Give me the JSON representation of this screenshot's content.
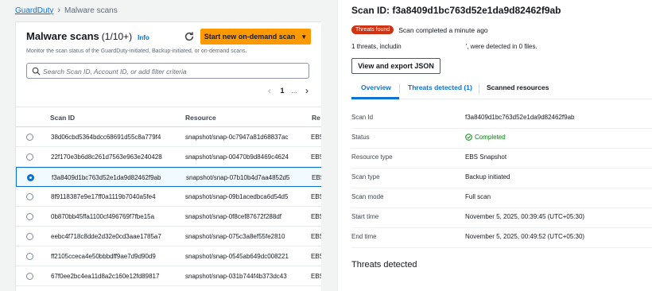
{
  "breadcrumb": {
    "root": "GuardDuty",
    "current": "Malware scans"
  },
  "left_panel": {
    "title": "Malware scans",
    "count": "(1/10+)",
    "info": "Info",
    "start_button": "Start new on-demand scan",
    "description": "Monitor the scan status of the GuardDuty-initiated, Backup-initiated, or on-demand scans.",
    "search_placeholder": "Search Scan ID, Account ID, or add filter criteria",
    "pagination": {
      "prev": "‹",
      "page": "1",
      "ellipsis": "...",
      "next": "›"
    },
    "columns": {
      "scan_id": "Scan ID",
      "resource": "Resource",
      "resource_type": "Re"
    },
    "rows": [
      {
        "scan_id": "38d06cbd5364bdcc68691d55c8a779f4",
        "resource": "snapshot/snap-0c7947a81d68837ac",
        "type": "EBS"
      },
      {
        "scan_id": "22f170e3b6d8c261d7563e963e240428",
        "resource": "snapshot/snap-00470b9d8469c4624",
        "type": "EBS"
      },
      {
        "scan_id": "f3a8409d1bc763d52e1da9d82462f9ab",
        "resource": "snapshot/snap-07b10b4d7aa4852d5",
        "type": "EBS"
      },
      {
        "scan_id": "8f9118387e9e17ff0a1119b7040a5fe4",
        "resource": "snapshot/snap-09b1acedbca6d54d5",
        "type": "EBS"
      },
      {
        "scan_id": "0b870bb45ffa1100cf496769f7fbe15a",
        "resource": "snapshot/snap-0f8cef87672f288df",
        "type": "EBS"
      },
      {
        "scan_id": "eebc4f718c8dde2d32e0cd3aae1785a7",
        "resource": "snapshot/snap-075c3a8ef55fe2810",
        "type": "EBS"
      },
      {
        "scan_id": "ff2105cceca4e50bbbdff9ae7d9d90d9",
        "resource": "snapshot/snap-0545ab649dc008221",
        "type": "EBS"
      },
      {
        "scan_id": "67f0ee2bc4ea11d8a2c160e12fd89817",
        "resource": "snapshot/snap-031b744f4b373dc43",
        "type": "EBS"
      }
    ]
  },
  "right_panel": {
    "title": "Scan ID: f3a8409d1bc763d52e1da9d82462f9ab",
    "badge": "Threats found",
    "completed": "Scan completed a minute ago",
    "threats_summary_a": "1 threats, includin",
    "threats_summary_b": "', were detected in 0 files.",
    "json_button": "View and export JSON",
    "tabs": {
      "overview": "Overview",
      "threats": "Threats detected (1)",
      "resources": "Scanned resources"
    },
    "details": [
      {
        "key": "Scan Id",
        "value": "f3a8409d1bc763d52e1da9d82462f9ab"
      },
      {
        "key": "Status",
        "value": "Completed"
      },
      {
        "key": "Resource type",
        "value": "EBS Snapshot"
      },
      {
        "key": "Scan type",
        "value": "Backup initiated"
      },
      {
        "key": "Scan mode",
        "value": "Full scan"
      },
      {
        "key": "Start time",
        "value": "November 5, 2025, 00:39:45 (UTC+05:30)"
      },
      {
        "key": "End time",
        "value": "November 5, 2025, 00:49:52 (UTC+05:30)"
      }
    ],
    "threats_heading": "Threats detected"
  },
  "colors": {
    "accent": "#0972d3",
    "primary_button": "#ff9900",
    "danger": "#d13212",
    "success": "#037f0c"
  },
  "icons": [
    "refresh-icon",
    "search-icon",
    "caret-down-icon",
    "check-circle-icon"
  ],
  "selected_row": 2
}
